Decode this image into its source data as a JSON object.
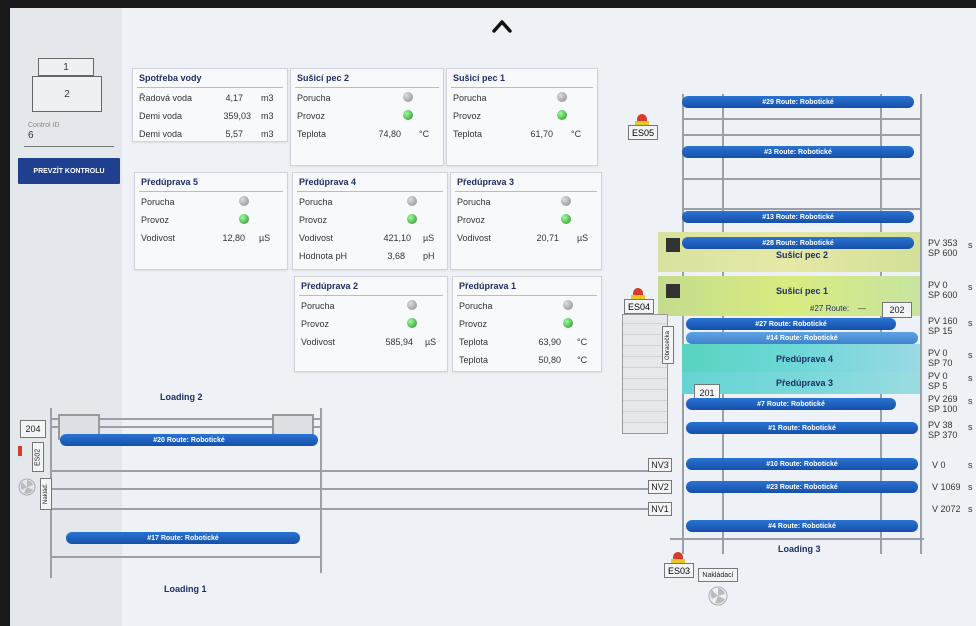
{
  "sidebar": {
    "box1": "1",
    "box2": "2",
    "control_id_label": "Control ID",
    "control_id_value": "6",
    "prevzit_button": "PREVZÍT KONTROLU"
  },
  "panels": {
    "spotreba": {
      "title": "Spotřeba vody",
      "rows": [
        {
          "label": "Řadová voda",
          "value": "4,17",
          "unit": "m3"
        },
        {
          "label": "Demi voda",
          "value": "359,03",
          "unit": "m3"
        },
        {
          "label": "Demi voda",
          "value": "5,57",
          "unit": "m3"
        }
      ]
    },
    "susici2": {
      "title": "Sušicí pec 2",
      "porucha": "Porucha",
      "provoz": "Provoz",
      "teplota_label": "Teplota",
      "teplota_value": "74,80",
      "teplota_unit": "°C"
    },
    "susici1": {
      "title": "Sušicí pec 1",
      "porucha": "Porucha",
      "provoz": "Provoz",
      "teplota_label": "Teplota",
      "teplota_value": "61,70",
      "teplota_unit": "°C"
    },
    "predu5": {
      "title": "Předúprava 5",
      "porucha": "Porucha",
      "provoz": "Provoz",
      "vodivost_label": "Vodivost",
      "vodivost_value": "12,80",
      "vodivost_unit": "µS"
    },
    "predu4": {
      "title": "Předúprava 4",
      "porucha": "Porucha",
      "provoz": "Provoz",
      "vodivost_label": "Vodivost",
      "vodivost_value": "421,10",
      "vodivost_unit": "µS",
      "ph_label": "Hodnota pH",
      "ph_value": "3,68",
      "ph_unit": "pH"
    },
    "predu3": {
      "title": "Předúprava 3",
      "porucha": "Porucha",
      "provoz": "Provoz",
      "vodivost_label": "Vodivost",
      "vodivost_value": "20,71",
      "vodivost_unit": "µS"
    },
    "predu2": {
      "title": "Předúprava 2",
      "porucha": "Porucha",
      "provoz": "Provoz",
      "vodivost_label": "Vodivost",
      "vodivost_value": "585,94",
      "vodivost_unit": "µS"
    },
    "predu1": {
      "title": "Předúprava 1",
      "porucha": "Porucha",
      "provoz": "Provoz",
      "teplota1_label": "Teplota",
      "teplota1_value": "63,90",
      "teplota1_unit": "°C",
      "teplota2_label": "Teplota",
      "teplota2_value": "50,80",
      "teplota2_unit": "°C"
    }
  },
  "left_area": {
    "loading2": "Loading 2",
    "loading1": "Loading 1",
    "tag204": "204",
    "es02": "ES02",
    "naklad": "Nakláď.",
    "route20": "#20 Route: Robotické",
    "route17": "#17 Route: Robotické"
  },
  "right_area": {
    "es05": "ES05",
    "es04": "ES04",
    "es03": "ES03",
    "naklad": "Nakládací",
    "obrat": "Obracečka",
    "nv3": "NV3",
    "nv2": "NV2",
    "nv1": "NV1",
    "tag202": "202",
    "tag201": "201",
    "loading3": "Loading 3",
    "routes": {
      "r29": "#29 Route: Robotické",
      "r3": "#3 Route: Robotické",
      "r13": "#13 Route: Robotické",
      "r28": "#28 Route: Robotické",
      "r27a": "#27 Route:",
      "r27a_dash": "—",
      "r27": "#27 Route: Robotické",
      "r14": "#14 Route: Robotické",
      "r7": "#7 Route: Robotické",
      "r1": "#1 Route: Robotické",
      "r10": "#10 Route: Robotické",
      "r23": "#23 Route: Robotické",
      "r4": "#4 Route: Robotické"
    },
    "zones": {
      "susici2": "Sušicí pec 2",
      "susici1": "Sušicí pec 1",
      "predu4": "Předúprava 4",
      "predu3": "Předúprava 3"
    },
    "pvsp": [
      {
        "pv": "PV 353",
        "sp": "SP 600"
      },
      {
        "pv": "PV 0",
        "sp": "SP 600"
      },
      {
        "pv": "PV 160",
        "sp": "SP 15"
      },
      {
        "pv": "PV 0",
        "sp": "SP 70"
      },
      {
        "pv": "PV 0",
        "sp": "SP 5"
      },
      {
        "pv": "PV 269",
        "sp": "SP 100"
      },
      {
        "pv": "PV 38",
        "sp": "SP 370"
      }
    ],
    "nv_values": {
      "nv3": "V 0",
      "nv2": "V 1069",
      "nv1": "V 2072"
    },
    "unit_s": "s"
  },
  "colors": {
    "accent": "#1f3f8f",
    "route_blue": "#1e5fc0",
    "led_green": "#2a8a2a",
    "es_red": "#d93b2b"
  }
}
